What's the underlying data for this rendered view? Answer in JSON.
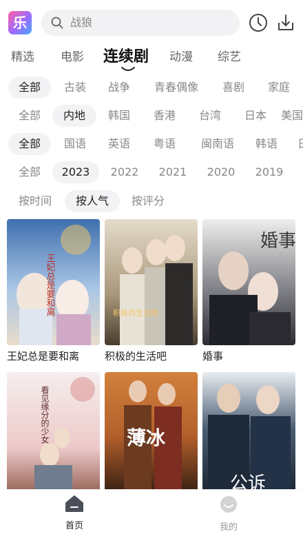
{
  "header": {
    "logo_text": "乐",
    "search": {
      "placeholder": "战狼"
    },
    "history_icon": "clock-icon",
    "download_icon": "download-icon"
  },
  "tabs": [
    {
      "label": "精选"
    },
    {
      "label": "电影"
    },
    {
      "label": "连续剧",
      "active": true
    },
    {
      "label": "动漫"
    },
    {
      "label": "综艺"
    }
  ],
  "filters": {
    "genre": [
      "全部",
      "古装",
      "战争",
      "青春偶像",
      "喜剧",
      "家庭"
    ],
    "region": [
      "全部",
      "内地",
      "韩国",
      "香港",
      "台湾",
      "日本",
      "美国"
    ],
    "language": [
      "全部",
      "国语",
      "英语",
      "粤语",
      "闽南语",
      "韩语",
      "日语"
    ],
    "year": [
      "全部",
      "2023",
      "2022",
      "2021",
      "2020",
      "2019"
    ],
    "sort": [
      "按时间",
      "按人气",
      "按评分"
    ]
  },
  "selected": {
    "genre": "全部",
    "region": "内地",
    "language": "全部",
    "year": "2023",
    "sort": "按人气"
  },
  "shows": [
    {
      "title": "王妃总是要和离",
      "poster_text": "王妃总是要和离",
      "colors": [
        "#4a77b4",
        "#b9d3ec",
        "#e9d8c4"
      ]
    },
    {
      "title": "积极的生活吧",
      "poster_text": "积极的生活吧",
      "colors": [
        "#d9c9a8",
        "#8f8169",
        "#3b3126"
      ]
    },
    {
      "title": "婚事",
      "poster_text": "婚事",
      "colors": [
        "#2e2f35",
        "#6e7078",
        "#c9c3ba"
      ]
    },
    {
      "title": "",
      "poster_text": "看见缘分的少女",
      "colors": [
        "#f4e9ea",
        "#e7b6b6",
        "#7b4a3f"
      ]
    },
    {
      "title": "",
      "poster_text": "薄冰",
      "colors": [
        "#c96f30",
        "#e49a4f",
        "#3a2215"
      ]
    },
    {
      "title": "",
      "poster_text": "公诉",
      "colors": [
        "#1e2b3c",
        "#3c4e63",
        "#cfd6de"
      ]
    }
  ],
  "bottom_nav": [
    {
      "label": "首页",
      "icon": "home-icon",
      "active": true
    },
    {
      "label": "我的",
      "icon": "profile-icon",
      "active": false
    }
  ],
  "colors": {
    "accent": "#222222",
    "chip_bg": "#f3f3f5",
    "muted": "#888888"
  }
}
